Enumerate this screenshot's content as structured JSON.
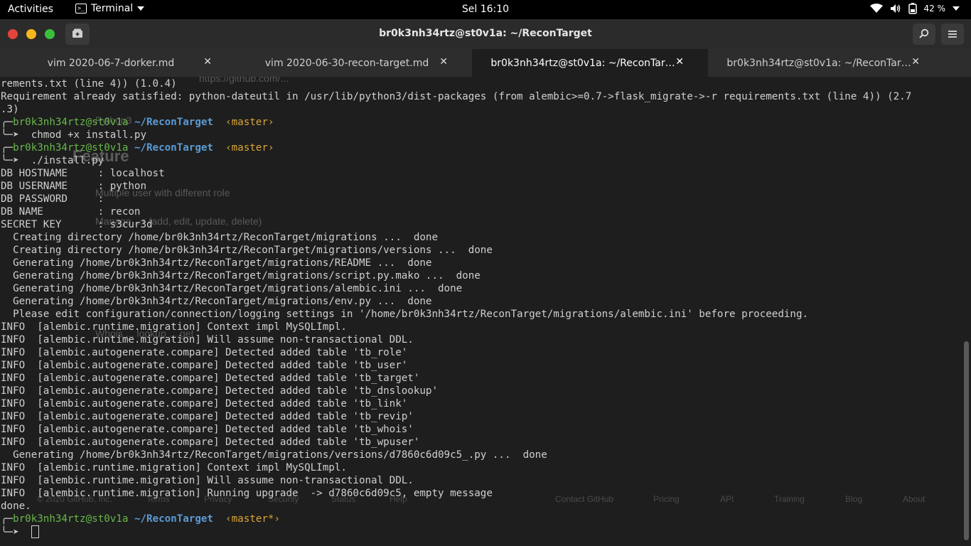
{
  "topbar": {
    "activities": "Activities",
    "app_name": "Terminal",
    "clock": "Sel 16:10",
    "battery_percent": "42 %"
  },
  "window": {
    "title": "br0k3nh34rtz@st0v1a: ~/ReconTarget"
  },
  "tabs": [
    {
      "label": "vim 2020-06-7-dorker.md",
      "close": "✕",
      "active": false
    },
    {
      "label": "vim 2020-06-30-recon-target.md",
      "close": "✕",
      "active": false
    },
    {
      "label": "br0k3nh34rtz@st0v1a: ~/ReconTar…",
      "close": "✕",
      "active": true
    },
    {
      "label": "br0k3nh34rtz@st0v1a: ~/ReconTar…",
      "close": "✕",
      "active": false
    }
  ],
  "terminal": {
    "lines": [
      "rements.txt (line 4)) (1.0.4)",
      "Requirement already satisfied: python-dateutil in /usr/lib/python3/dist-packages (from alembic>=0.7->flask_migrate->-r requirements.txt (line 4)) (2.7",
      ".3)",
      "",
      "  chmod +x install.py",
      "",
      "  ./install.py",
      "DB HOSTNAME     : localhost",
      "DB USERNAME     : python",
      "DB PASSWORD     :",
      "DB NAME         : recon",
      "SECRET KEY      : s3cur3d",
      "  Creating directory /home/br0k3nh34rtz/ReconTarget/migrations ...  done",
      "  Creating directory /home/br0k3nh34rtz/ReconTarget/migrations/versions ...  done",
      "  Generating /home/br0k3nh34rtz/ReconTarget/migrations/README ...  done",
      "  Generating /home/br0k3nh34rtz/ReconTarget/migrations/script.py.mako ...  done",
      "  Generating /home/br0k3nh34rtz/ReconTarget/migrations/alembic.ini ...  done",
      "  Generating /home/br0k3nh34rtz/ReconTarget/migrations/env.py ...  done",
      "  Please edit configuration/connection/logging settings in '/home/br0k3nh34rtz/ReconTarget/migrations/alembic.ini' before proceeding.",
      "INFO  [alembic.runtime.migration] Context impl MySQLImpl.",
      "INFO  [alembic.runtime.migration] Will assume non-transactional DDL.",
      "INFO  [alembic.autogenerate.compare] Detected added table 'tb_role'",
      "INFO  [alembic.autogenerate.compare] Detected added table 'tb_user'",
      "INFO  [alembic.autogenerate.compare] Detected added table 'tb_target'",
      "INFO  [alembic.autogenerate.compare] Detected added table 'tb_dnslookup'",
      "INFO  [alembic.autogenerate.compare] Detected added table 'tb_link'",
      "INFO  [alembic.autogenerate.compare] Detected added table 'tb_revip'",
      "INFO  [alembic.autogenerate.compare] Detected added table 'tb_whois'",
      "INFO  [alembic.autogenerate.compare] Detected added table 'tb_wpuser'",
      "  Generating /home/br0k3nh34rtz/ReconTarget/migrations/versions/d7860c6d09c5_.py ...  done",
      "INFO  [alembic.runtime.migration] Context impl MySQLImpl.",
      "INFO  [alembic.runtime.migration] Will assume non-transactional DDL.",
      "INFO  [alembic.runtime.migration] Running upgrade  -> d7860c6d09c5, empty message",
      "done."
    ],
    "prompts": [
      {
        "user": "br0k3nh34rtz@st0v1a",
        "path": "~/ReconTarget",
        "branch": "‹master›"
      },
      {
        "user": "br0k3nh34rtz@st0v1a",
        "path": "~/ReconTarget",
        "branch": "‹master›"
      },
      {
        "user": "br0k3nh34rtz@st0v1a",
        "path": "~/ReconTarget",
        "branch": "‹master*›"
      }
    ],
    "background_ghost": {
      "url_fragment": "https://github.com/...",
      "bullet_python": "Python3",
      "heading": "Feature",
      "bullet_multiple_user": "Multiple user with different role",
      "bullet_manage": "Manage ...r (add, edit, update, delete)",
      "bullet_whois": "Whois ... lookup ... get",
      "footer_copyright": "© 2020 GitHub, Inc.",
      "footer_links": [
        "Terms",
        "Privacy",
        "Security",
        "Status",
        "Help",
        "Contact GitHub",
        "Pricing",
        "API",
        "Training",
        "Blog",
        "About"
      ]
    }
  }
}
